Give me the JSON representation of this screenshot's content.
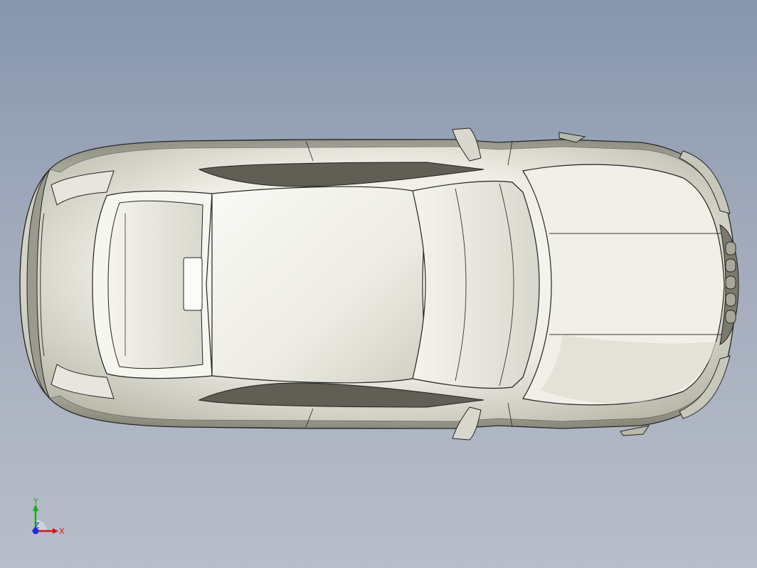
{
  "viewport": {
    "background_top": "#8796ad",
    "background_bottom": "#b8bdc9",
    "model_fill": "#f2f2ec",
    "model_edge": "#2a2a26"
  },
  "triad": {
    "x_label": "X",
    "y_label": "Y",
    "z_label": "Z",
    "x_color": "#d01818",
    "y_color": "#18b018",
    "z_color": "#1830d8"
  }
}
